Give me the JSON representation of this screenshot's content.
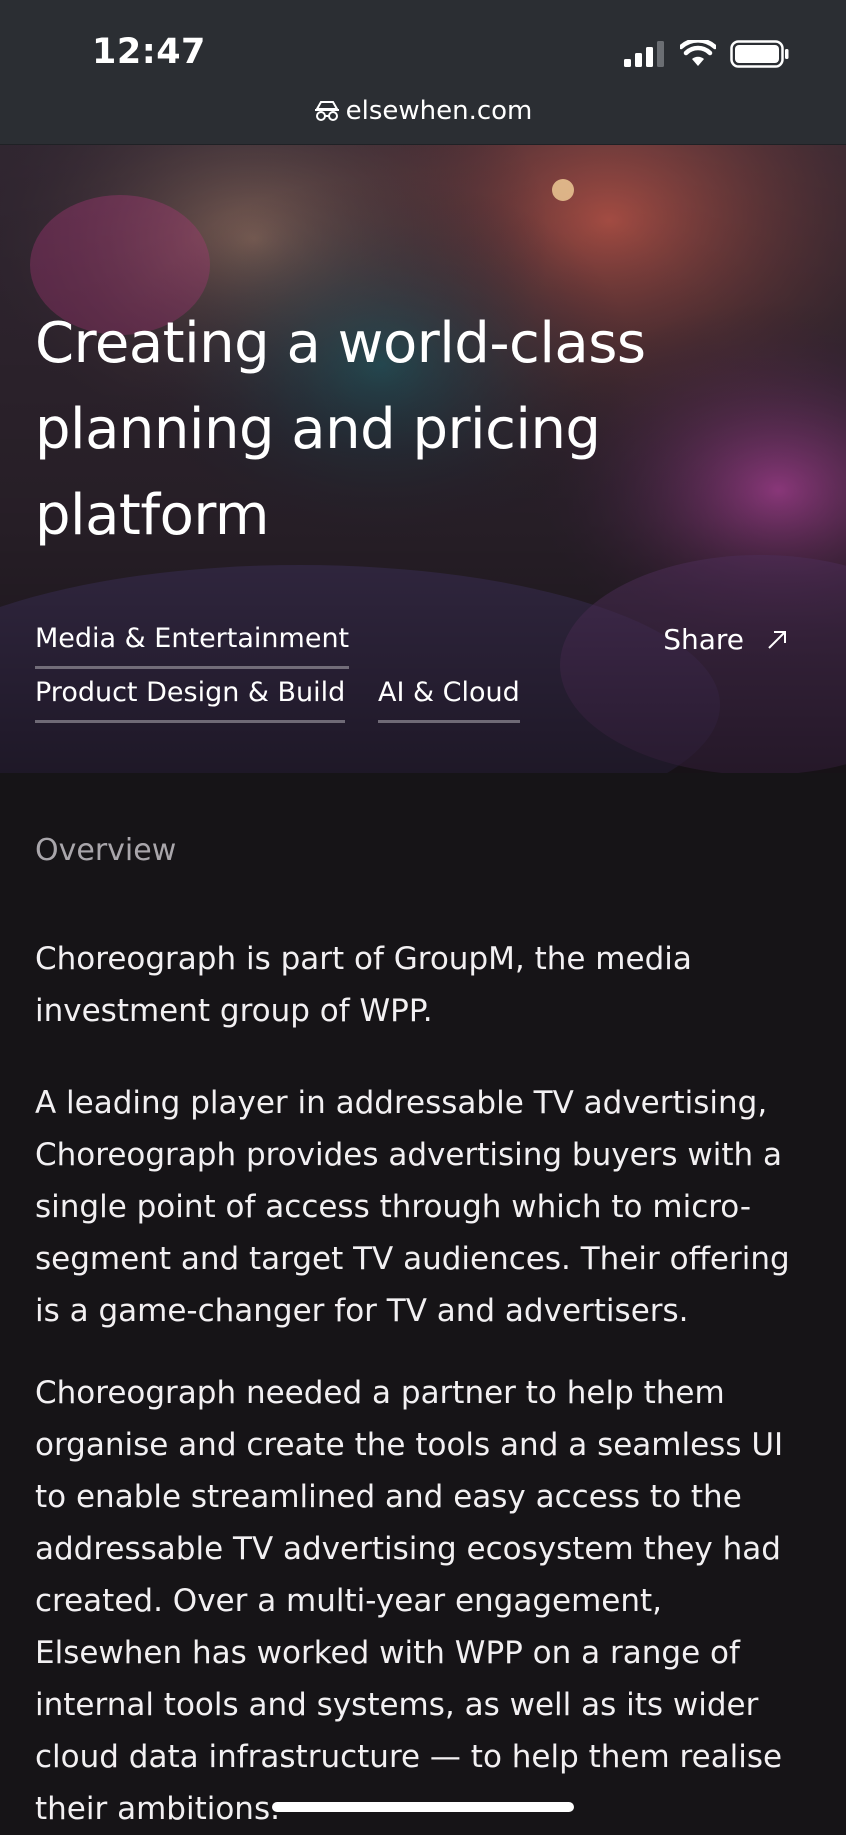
{
  "status_bar": {
    "time": "12:47",
    "icons": [
      "signal-icon",
      "wifi-icon",
      "battery-icon"
    ]
  },
  "browser": {
    "url": "elsewhen.com",
    "url_icon": "incognito-icon"
  },
  "hero": {
    "title": "Creating a world-class planning and pricing platform",
    "tags": [
      "Media & Entertainment",
      "Product Design & Build",
      "AI & Cloud"
    ],
    "share_label": "Share",
    "share_icon": "arrow-up-right-icon"
  },
  "content": {
    "section_label": "Overview",
    "paragraphs": [
      "Choreograph is part of GroupM, the media investment group of WPP.",
      "A leading player in addressable TV advertising, Choreograph provides advertising buyers with a single point of access through which to micro-segment and target TV audiences. Their offering is a game-changer for TV and advertisers.",
      "Choreograph needed a partner to help them organise and create the tools and a seamless UI to enable streamlined and easy access to the addressable TV advertising ecosystem they had created. Over a multi-year engagement, Elsewhen has worked with WPP on a range of internal tools and systems, as well as its wider cloud data infrastructure — to help them realise their ambitions."
    ]
  },
  "colors": {
    "background": "#161417",
    "status_bar": "#2b2e33",
    "text": "#f2f0f2",
    "muted_text": "#a9a6ab"
  }
}
